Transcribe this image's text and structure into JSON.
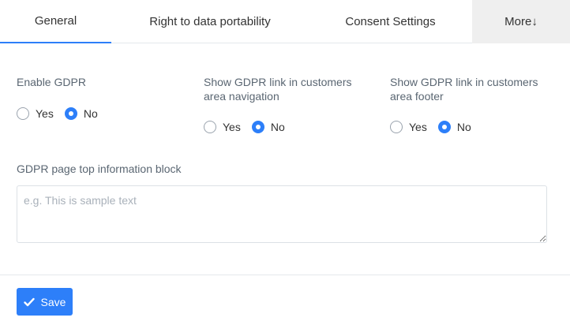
{
  "tabs": {
    "general": "General",
    "portability": "Right to data portability",
    "consent": "Consent Settings",
    "more": "More↓"
  },
  "settings": {
    "enable_gdpr": {
      "label": "Enable GDPR",
      "yes": "Yes",
      "no": "No",
      "selected": "No"
    },
    "show_link_nav": {
      "label": "Show GDPR link in customers area navigation",
      "yes": "Yes",
      "no": "No",
      "selected": "No"
    },
    "show_link_footer": {
      "label": "Show GDPR link in customers area footer",
      "yes": "Yes",
      "no": "No",
      "selected": "No"
    },
    "top_block": {
      "label": "GDPR page top information block",
      "value": "",
      "placeholder": "e.g. This is sample text"
    }
  },
  "footer": {
    "save_label": "Save"
  },
  "icons": {
    "save": "check-icon"
  },
  "colors": {
    "accent": "#2d7ff9",
    "more_tab_bg": "#efefef"
  }
}
